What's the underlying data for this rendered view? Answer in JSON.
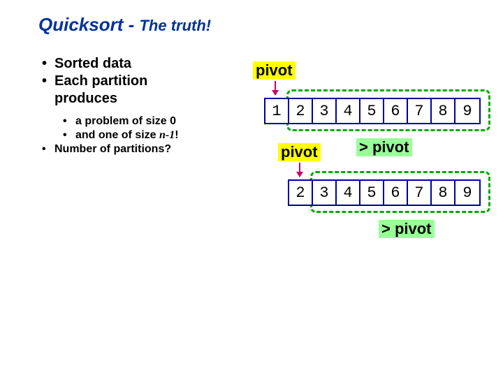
{
  "title": {
    "main": "Quicksort -",
    "sub": "The truth!"
  },
  "bullets": {
    "b1": "Sorted data",
    "b2a": "Each partition",
    "b2b": "produces",
    "s1": "a problem of size 0",
    "s2a": "and one of size ",
    "s2b": "n-1",
    "s2c": "!",
    "b3": "Number of partitions?"
  },
  "labels": {
    "pivot": "pivot",
    "gt_pivot": "> pivot"
  },
  "arrays": {
    "row1": [
      "1",
      "2",
      "3",
      "4",
      "5",
      "6",
      "7",
      "8",
      "9"
    ],
    "row2": [
      "2",
      "3",
      "4",
      "5",
      "6",
      "7",
      "8",
      "9"
    ]
  }
}
